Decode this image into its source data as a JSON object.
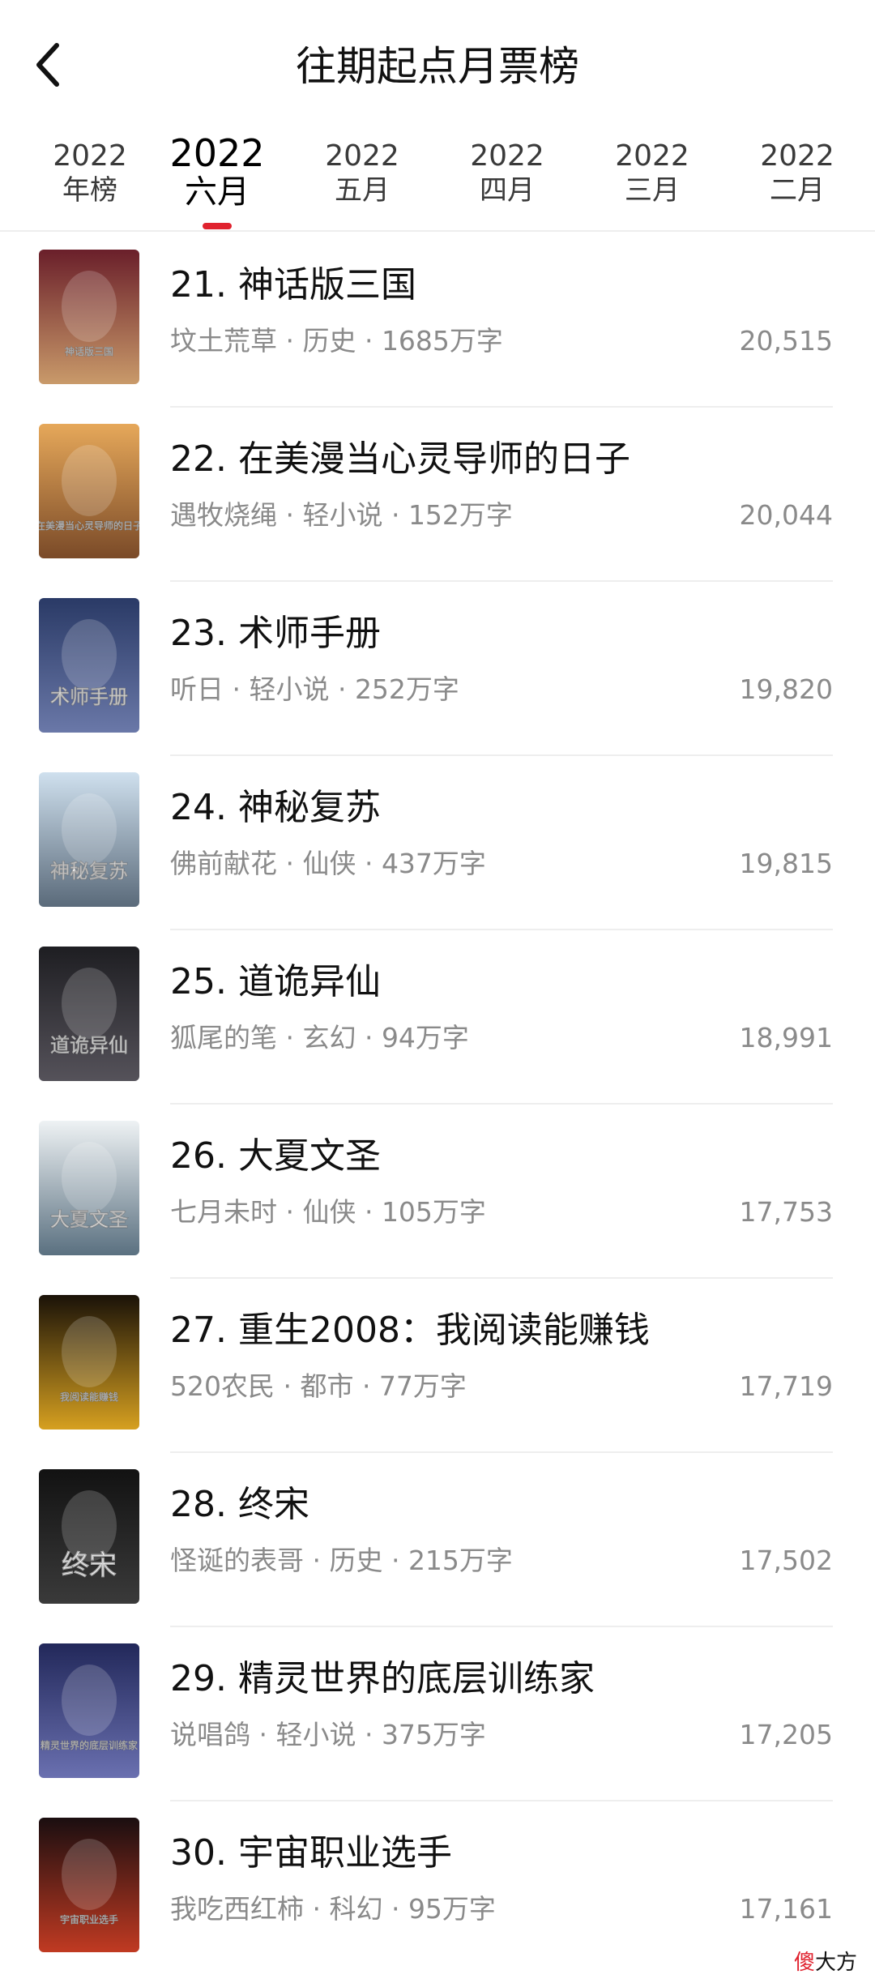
{
  "header": {
    "title": "往期起点月票榜"
  },
  "tabs": [
    {
      "year": "2022",
      "month": "年榜"
    },
    {
      "year": "2022",
      "month": "六月"
    },
    {
      "year": "2022",
      "month": "五月"
    },
    {
      "year": "2022",
      "month": "四月"
    },
    {
      "year": "2022",
      "month": "三月"
    },
    {
      "year": "2022",
      "month": "二月"
    }
  ],
  "active_tab": "六月",
  "books": [
    {
      "title": "21. 神话版三国",
      "meta": "坟土荒草 · 历史 · 1685万字",
      "votes": "20,515",
      "cover_text": "神话版三国",
      "cover_colors": [
        "#6a1f2a",
        "#c99a6a"
      ]
    },
    {
      "title": "22. 在美漫当心灵导师的日子",
      "meta": "遇牧烧绳 · 轻小说 · 152万字",
      "votes": "20,044",
      "cover_text": "在美漫当心灵导师的日子",
      "cover_colors": [
        "#e6a85a",
        "#7a4a28"
      ]
    },
    {
      "title": "23. 术师手册",
      "meta": "听日 · 轻小说 · 252万字",
      "votes": "19,820",
      "cover_text": "术师手册",
      "cover_colors": [
        "#2a3a66",
        "#6a78a8"
      ]
    },
    {
      "title": "24. 神秘复苏",
      "meta": "佛前献花 · 仙侠 · 437万字",
      "votes": "19,815",
      "cover_text": "神秘复苏",
      "cover_colors": [
        "#cfe0ee",
        "#5a6a7a"
      ]
    },
    {
      "title": "25. 道诡异仙",
      "meta": "狐尾的笔 · 玄幻 · 94万字",
      "votes": "18,991",
      "cover_text": "道诡异仙",
      "cover_colors": [
        "#1e1e22",
        "#55525a"
      ]
    },
    {
      "title": "26. 大夏文圣",
      "meta": "七月未时 · 仙侠 · 105万字",
      "votes": "17,753",
      "cover_text": "大夏文圣",
      "cover_colors": [
        "#eef2f4",
        "#5a7080"
      ]
    },
    {
      "title": "27. 重生2008：我阅读能赚钱",
      "meta": "520农民 · 都市 · 77万字",
      "votes": "17,719",
      "cover_text": "我阅读能赚钱",
      "cover_colors": [
        "#1a1208",
        "#d6a020"
      ]
    },
    {
      "title": "28. 终宋",
      "meta": "怪诞的表哥 · 历史 · 215万字",
      "votes": "17,502",
      "cover_text": "终宋",
      "cover_colors": [
        "#121212",
        "#3a3a3a"
      ]
    },
    {
      "title": "29. 精灵世界的底层训练家",
      "meta": "说唱鸽 · 轻小说 · 375万字",
      "votes": "17,205",
      "cover_text": "精灵世界的底层训练家",
      "cover_colors": [
        "#22285a",
        "#6a70b0"
      ]
    },
    {
      "title": "30. 宇宙职业选手",
      "meta": "我吃西红柿 · 科幻 · 95万字",
      "votes": "17,161",
      "cover_text": "宇宙职业选手",
      "cover_colors": [
        "#1a0e10",
        "#c03a22"
      ]
    }
  ],
  "watermark": {
    "red": "傻",
    "rest": "大方"
  }
}
